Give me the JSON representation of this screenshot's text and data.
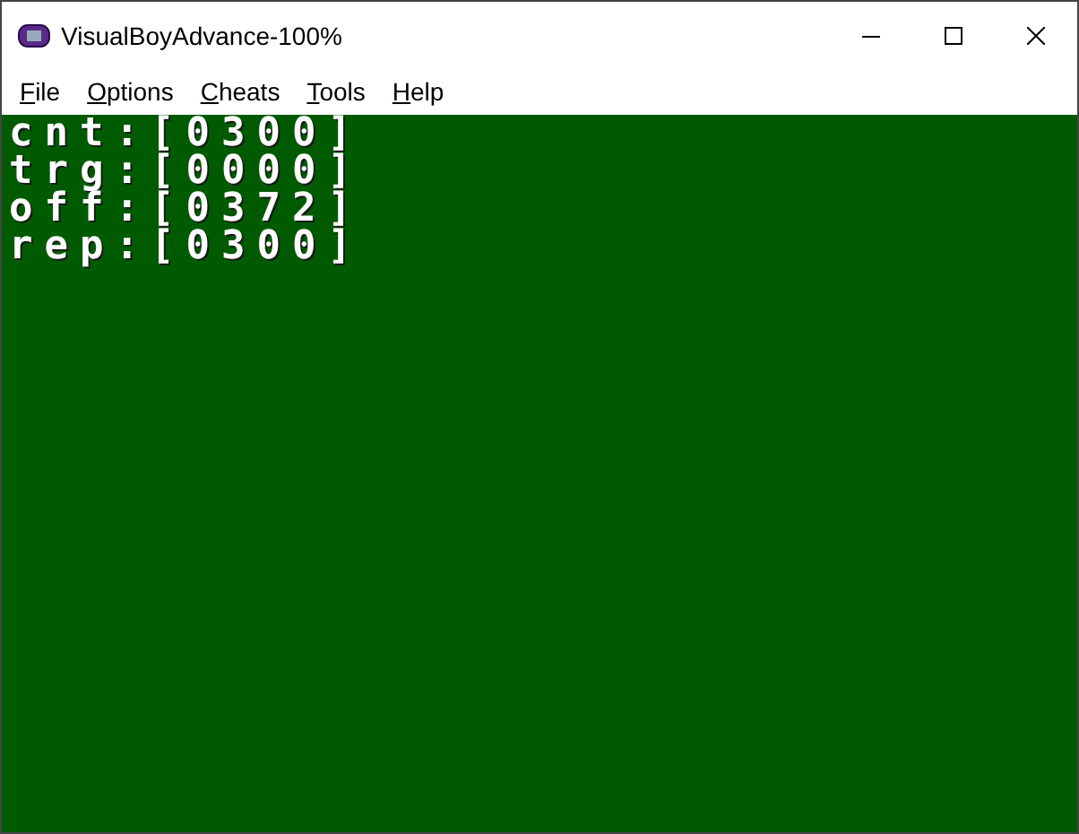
{
  "window": {
    "title": "VisualBoyAdvance-100%"
  },
  "menu": [
    {
      "label": "File",
      "first_letter_underlined": true
    },
    {
      "label": "Options",
      "first_letter_underlined": true
    },
    {
      "label": "Cheats",
      "first_letter_underlined": true
    },
    {
      "label": "Tools",
      "first_letter_underlined": true
    },
    {
      "label": "Help",
      "first_letter_underlined": true
    }
  ],
  "screen": {
    "lines": [
      "cnt:[0300]",
      "trg:[0000]",
      "off:[0372]",
      "rep:[0300]"
    ]
  }
}
